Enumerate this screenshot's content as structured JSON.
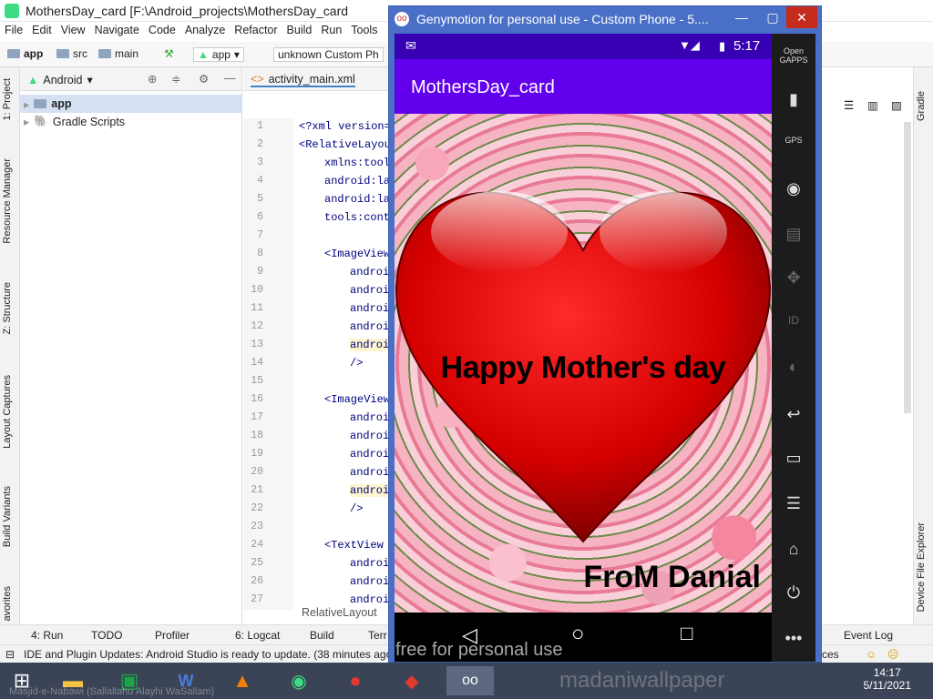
{
  "studio": {
    "title": "MothersDay_card [F:\\Android_projects\\MothersDay_card",
    "menu": [
      "File",
      "Edit",
      "View",
      "Navigate",
      "Code",
      "Analyze",
      "Refactor",
      "Build",
      "Run",
      "Tools"
    ],
    "breadcrumbs": [
      "app",
      "src",
      "main"
    ],
    "run_config": "app",
    "device": "unknown Custom Ph",
    "project_view": "Android",
    "tree": [
      "app",
      "Gradle Scripts"
    ],
    "tab": "activity_main.xml",
    "left_tabs": [
      "1: Project",
      "Resource Manager",
      "Z: Structure",
      "Layout Captures",
      "Build Variants",
      "avorites"
    ],
    "right_tabs": [
      "Gradle",
      "Device File Explorer"
    ],
    "line_numbers": [
      "1",
      "2",
      "3",
      "4",
      "5",
      "6",
      "7",
      "8",
      "9",
      "10",
      "11",
      "12",
      "13",
      "14",
      "15",
      "16",
      "17",
      "18",
      "19",
      "20",
      "21",
      "22",
      "23",
      "24",
      "25",
      "26",
      "27"
    ],
    "code_lines": [
      "<?xml version=",
      "<RelativeLayou",
      "xmlns:tool",
      "android:la",
      "android:la",
      "tools:cont",
      "",
      "<ImageView",
      "androi",
      "androi",
      "androi",
      "androi",
      "androi",
      "/>",
      "",
      "<ImageView",
      "androi",
      "androi",
      "androi",
      "androi",
      "androi",
      "/>",
      "",
      "<TextView",
      "androi",
      "androi",
      "androi"
    ],
    "breadcrumb_bottom": "RelativeLayout",
    "bottom_tools": [
      "4: Run",
      "TODO",
      "Profiler",
      "6: Logcat",
      "Build",
      "Terr"
    ],
    "event_log": "Event Log",
    "status_text": "IDE and Plugin Updates: Android Studio is ready to update. (38 minutes ago)",
    "status_right": "ces"
  },
  "genymotion": {
    "title": "Genymotion for personal use - Custom Phone - 5....",
    "time": "5:17",
    "app_title": "MothersDay_card",
    "phrase": "Happy Mother's day",
    "from": "FroM Danial",
    "sidebar": [
      "Open GAPPS",
      "battery-icon",
      "GPS",
      "webcam-icon",
      "clapper-icon",
      "move-icon",
      "ID",
      "media-icon",
      "back-icon",
      "recent-icon",
      "menu-icon",
      "home-icon",
      "power-icon",
      "more-icon"
    ],
    "watermark": "free for personal use"
  },
  "taskbar": {
    "time": "14:17",
    "date": "5/11/2021",
    "bg_text": "Masjid-e-Nabawi (Sallallahu Alayhi WaSallam)",
    "wallpaper_text": "madaniwallpaper"
  }
}
